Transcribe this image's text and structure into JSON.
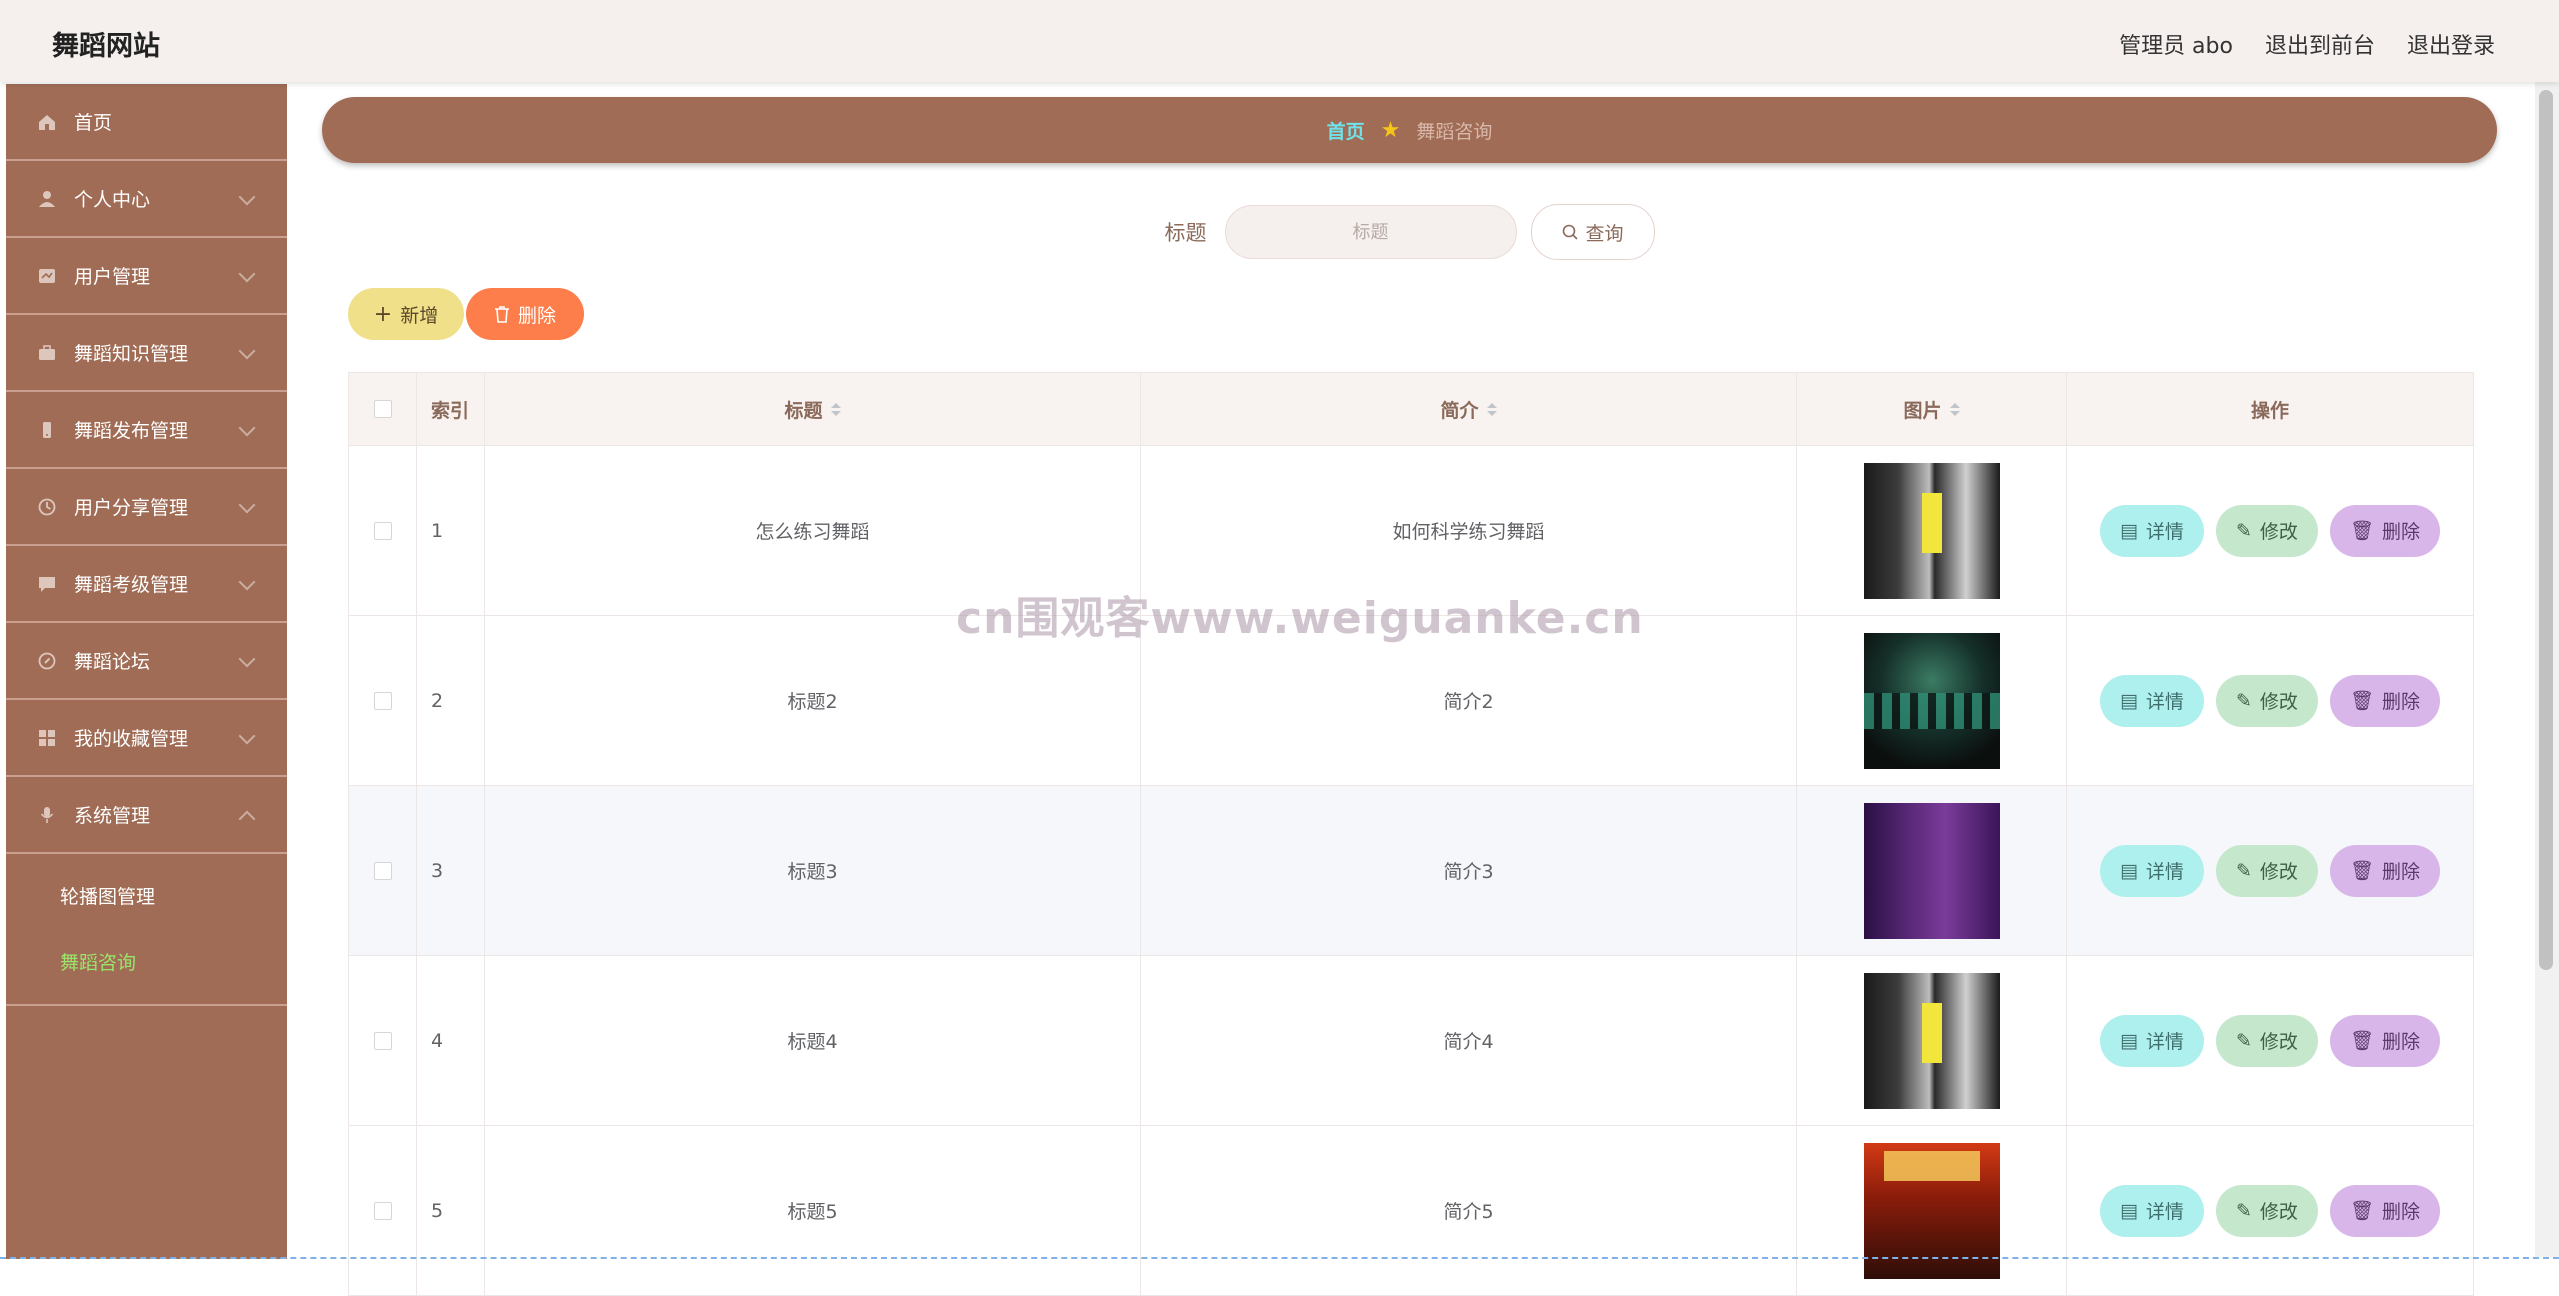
{
  "header": {
    "brand": "舞蹈网站",
    "admin": "管理员 abo",
    "to_front": "退出到前台",
    "logout": "退出登录"
  },
  "sidebar": {
    "items": [
      {
        "label": "首页",
        "icon": "home-icon"
      },
      {
        "label": "个人中心",
        "icon": "user-icon"
      },
      {
        "label": "用户管理",
        "icon": "card-icon"
      },
      {
        "label": "舞蹈知识管理",
        "icon": "briefcase-icon"
      },
      {
        "label": "舞蹈发布管理",
        "icon": "phone-icon"
      },
      {
        "label": "用户分享管理",
        "icon": "clock-icon"
      },
      {
        "label": "舞蹈考级管理",
        "icon": "chat-icon"
      },
      {
        "label": "舞蹈论坛",
        "icon": "compass-icon"
      },
      {
        "label": "我的收藏管理",
        "icon": "grid-icon"
      },
      {
        "label": "系统管理",
        "icon": "mic-icon"
      }
    ],
    "sub_items": [
      {
        "label": "轮播图管理",
        "active": false
      },
      {
        "label": "舞蹈咨询",
        "active": true
      }
    ]
  },
  "breadcrumb": {
    "home": "首页",
    "current": "舞蹈咨询"
  },
  "search": {
    "label": "标题",
    "placeholder": "标题",
    "button": "查询"
  },
  "actions": {
    "add": "新增",
    "delete": "删除"
  },
  "table": {
    "headers": {
      "index": "索引",
      "title": "标题",
      "intro": "简介",
      "picture": "图片",
      "ops": "操作"
    },
    "rows": [
      {
        "index": "1",
        "title": "怎么练习舞蹈",
        "intro": "如何科学练习舞蹈"
      },
      {
        "index": "2",
        "title": "标题2",
        "intro": "简介2"
      },
      {
        "index": "3",
        "title": "标题3",
        "intro": "简介3"
      },
      {
        "index": "4",
        "title": "标题4",
        "intro": "简介4"
      },
      {
        "index": "5",
        "title": "标题5",
        "intro": "简介5"
      }
    ],
    "op_labels": {
      "detail": "详情",
      "edit": "修改",
      "delete": "删除"
    }
  },
  "watermark": "cn围观客www.weiguanke.cn",
  "colors": {
    "sidebar": "#a06c55",
    "topbar": "#f5efed",
    "active_sub": "#9be46a",
    "breadcrumb_home": "#6fe3ec"
  }
}
